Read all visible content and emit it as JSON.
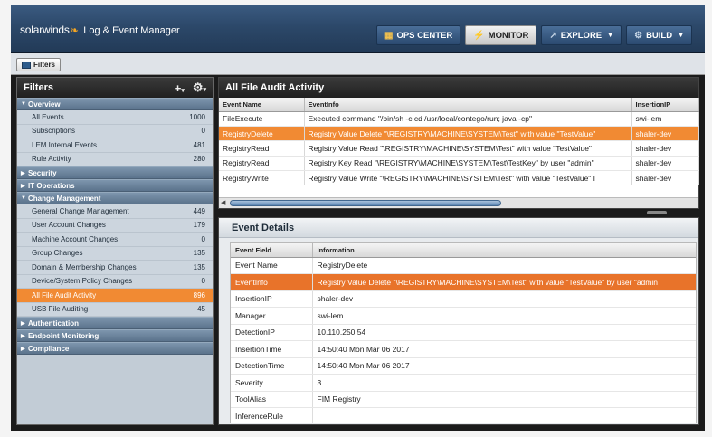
{
  "header": {
    "brand": "solarwinds",
    "product": "Log & Event Manager",
    "nav": [
      {
        "label": "OPS CENTER",
        "icon": "grid-icon",
        "dropdown": false,
        "active": false
      },
      {
        "label": "MONITOR",
        "icon": "lightning-icon",
        "dropdown": false,
        "active": true
      },
      {
        "label": "EXPLORE",
        "icon": "explore-icon",
        "dropdown": true,
        "active": false
      },
      {
        "label": "BUILD",
        "icon": "gear-icon",
        "dropdown": true,
        "active": false
      }
    ]
  },
  "tabs": {
    "filters_label": "Filters"
  },
  "sidebar": {
    "title": "Filters",
    "add_icon": "plus-icon",
    "settings_icon": "gear-icon",
    "groups": [
      {
        "label": "Overview",
        "expanded": true,
        "items": [
          {
            "label": "All Events",
            "count": "1000"
          },
          {
            "label": "Subscriptions",
            "count": "0"
          },
          {
            "label": "LEM Internal Events",
            "count": "481"
          },
          {
            "label": "Rule Activity",
            "count": "280"
          }
        ]
      },
      {
        "label": "Security",
        "expanded": false,
        "items": []
      },
      {
        "label": "IT Operations",
        "expanded": false,
        "items": []
      },
      {
        "label": "Change Management",
        "expanded": true,
        "items": [
          {
            "label": "General Change Management",
            "count": "449"
          },
          {
            "label": "User Account Changes",
            "count": "179"
          },
          {
            "label": "Machine Account Changes",
            "count": "0"
          },
          {
            "label": "Group Changes",
            "count": "135"
          },
          {
            "label": "Domain & Membership Changes",
            "count": "135"
          },
          {
            "label": "Device/System Policy Changes",
            "count": "0"
          },
          {
            "label": "All File Audit Activity",
            "count": "896",
            "selected": true
          },
          {
            "label": "USB File Auditing",
            "count": "45"
          }
        ]
      },
      {
        "label": "Authentication",
        "expanded": false,
        "items": []
      },
      {
        "label": "Endpoint Monitoring",
        "expanded": false,
        "items": []
      },
      {
        "label": "Compliance",
        "expanded": false,
        "items": []
      }
    ]
  },
  "audit": {
    "title": "All File Audit Activity",
    "columns": [
      "Event Name",
      "EventInfo",
      "InsertionIP"
    ],
    "rows": [
      [
        "FileExecute",
        "Executed command \"/bin/sh -c cd /usr/local/contego/run; java -cp\"",
        "swi-lem"
      ],
      [
        "RegistryDelete",
        "Registry Value Delete \"\\REGISTRY\\MACHINE\\SYSTEM\\Test\" with value \"TestValue\"",
        "shaler-dev"
      ],
      [
        "RegistryRead",
        "Registry Value Read \"\\REGISTRY\\MACHINE\\SYSTEM\\Test\" with value \"TestValue\"",
        "shaler-dev"
      ],
      [
        "RegistryRead",
        "Registry Key Read \"\\REGISTRY\\MACHINE\\SYSTEM\\Test\\TestKey\" by user \"admin\"",
        "shaler-dev"
      ],
      [
        "RegistryWrite",
        "Registry Value Write \"\\REGISTRY\\MACHINE\\SYSTEM\\Test\" with value \"TestValue\" I",
        "shaler-dev"
      ]
    ],
    "selected_row": 1
  },
  "details": {
    "title": "Event Details",
    "columns": [
      "Event Field",
      "Information"
    ],
    "rows": [
      [
        "Event Name",
        "RegistryDelete"
      ],
      [
        "EventInfo",
        "Registry Value Delete \"\\REGISTRY\\MACHINE\\SYSTEM\\Test\" with value \"TestValue\" by user \"admin"
      ],
      [
        "InsertionIP",
        "shaler-dev"
      ],
      [
        "Manager",
        "swi-lem"
      ],
      [
        "DetectionIP",
        "10.110.250.54"
      ],
      [
        "InsertionTime",
        "14:50:40 Mon Mar 06 2017"
      ],
      [
        "DetectionTime",
        "14:50:40 Mon Mar 06 2017"
      ],
      [
        "Severity",
        "3"
      ],
      [
        "ToolAlias",
        "FIM Registry"
      ],
      [
        "InferenceRule",
        ""
      ]
    ],
    "selected_row": 1
  },
  "colors": {
    "accent": "#f18a33",
    "header": "#2c4869",
    "panel": "#c2ccd6"
  }
}
